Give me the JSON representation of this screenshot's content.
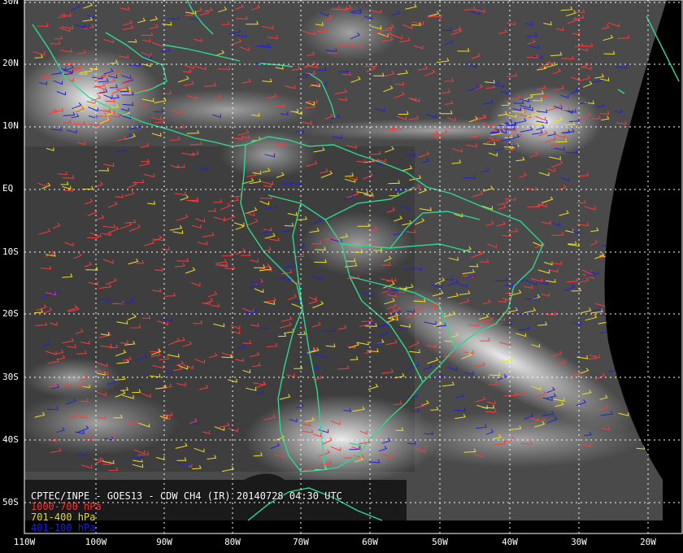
{
  "caption": "CPTEC/INPE - GOES13 - CDW CH4 (IR) 20140728 04:30 UTC",
  "legend": [
    {
      "label": "1000-700 hPa",
      "color": "#ff3a3a"
    },
    {
      "label": "701-400 hPa",
      "color": "#f0e020"
    },
    {
      "label": "401-100 hPa",
      "color": "#2020d8"
    }
  ],
  "lat_labels": [
    "30N",
    "20N",
    "10N",
    "EQ",
    "10S",
    "20S",
    "30S",
    "40S",
    "50S"
  ],
  "lon_labels": [
    "110W",
    "100W",
    "90W",
    "80W",
    "70W",
    "60W",
    "50W",
    "40W",
    "30W",
    "20W"
  ],
  "colors": {
    "coastline": "#30d890",
    "grid": "#ffffff",
    "background": "#000000"
  }
}
